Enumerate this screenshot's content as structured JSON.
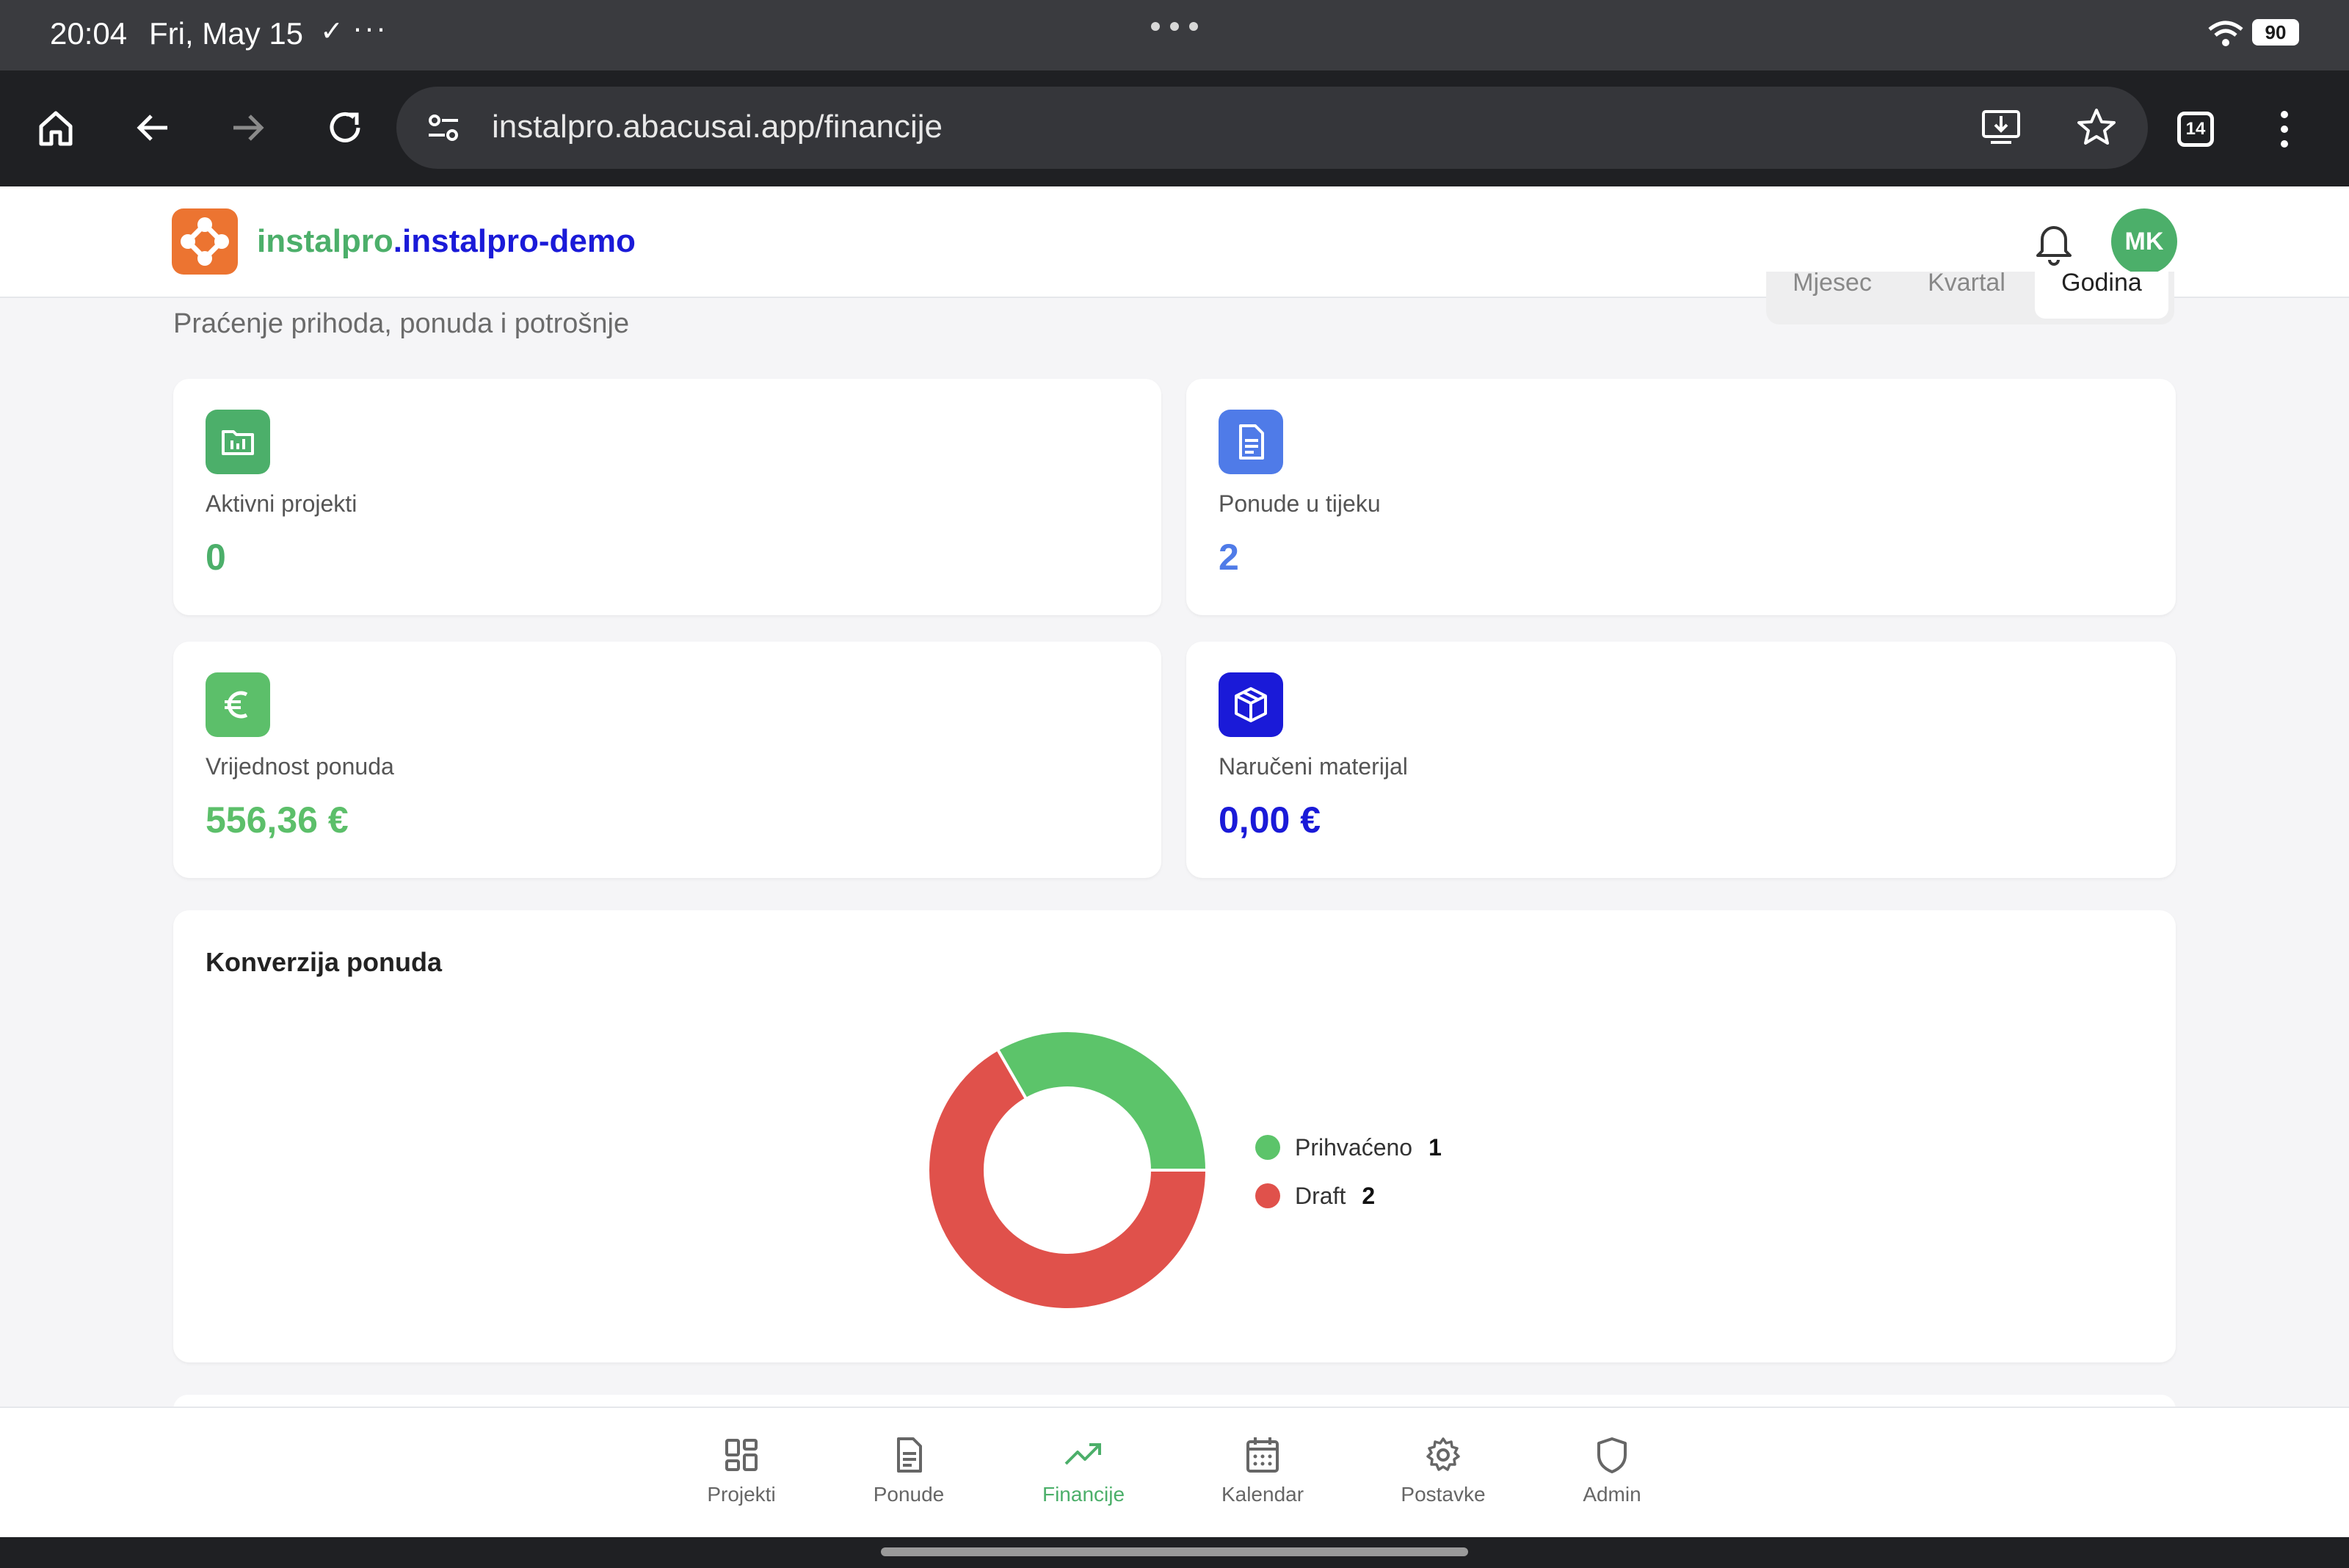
{
  "status": {
    "time": "20:04",
    "date": "Fri, May 15",
    "battery": "90"
  },
  "browser": {
    "url": "instalpro.abacusai.app/financije",
    "tab_count": "14"
  },
  "header": {
    "brand_part1": "instalpro",
    "brand_part2": ".instalpro-demo",
    "avatar_initials": "MK"
  },
  "page": {
    "subtitle": "Praćenje prihoda, ponuda i potrošnje",
    "period_tabs": [
      "Mjesec",
      "Kvartal",
      "Godina"
    ]
  },
  "stats": [
    {
      "label": "Aktivni projekti",
      "value": "0",
      "color": "#4caf6a",
      "icon": "folder-chart-icon"
    },
    {
      "label": "Ponude u tijeku",
      "value": "2",
      "color": "#4f7be8",
      "icon": "document-icon"
    },
    {
      "label": "Vrijednost ponuda",
      "value": "556,36 €",
      "color": "#5cbf6a",
      "icon": "euro-icon"
    },
    {
      "label": "Naručeni materijal",
      "value": "0,00 €",
      "color": "#1a1ad8",
      "icon": "package-icon"
    }
  ],
  "conversion": {
    "title": "Konverzija ponuda",
    "legend": [
      {
        "label": "Prihvaćeno",
        "count": "1",
        "color": "#5cc46a"
      },
      {
        "label": "Draft",
        "count": "2",
        "color": "#e0514b"
      }
    ]
  },
  "chart_data": {
    "type": "pie",
    "title": "Konverzija ponuda",
    "categories": [
      "Prihvaćeno",
      "Draft"
    ],
    "values": [
      1,
      2
    ],
    "colors": [
      "#5cc46a",
      "#e0514b"
    ],
    "legend": "right"
  },
  "nav": [
    {
      "label": "Projekti",
      "icon": "grid-icon"
    },
    {
      "label": "Ponude",
      "icon": "document-icon"
    },
    {
      "label": "Financije",
      "icon": "trending-up-icon"
    },
    {
      "label": "Kalendar",
      "icon": "calendar-icon"
    },
    {
      "label": "Postavke",
      "icon": "gear-icon"
    },
    {
      "label": "Admin",
      "icon": "shield-icon"
    }
  ]
}
